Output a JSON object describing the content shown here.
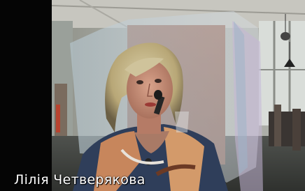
{
  "participant": {
    "name": "Лілія Четверякова"
  },
  "colors": {
    "left_bar": "#050505",
    "label_text": "#ffffff"
  },
  "icons": {
    "video": "participant-video-feed"
  }
}
